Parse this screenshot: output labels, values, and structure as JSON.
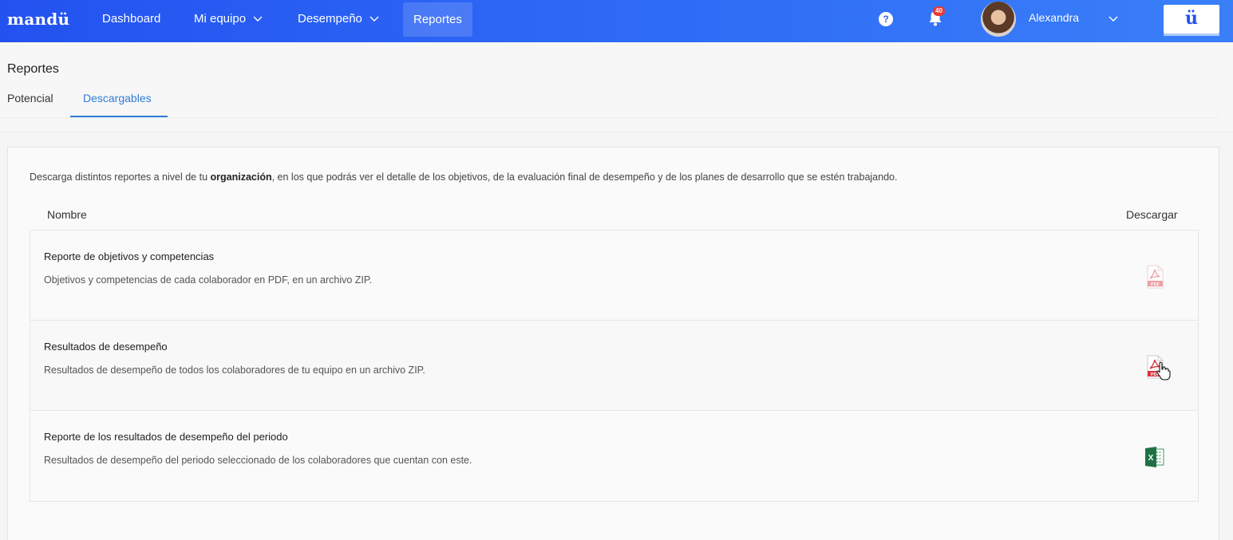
{
  "app": {
    "logo": "mandü",
    "brand_button": "ü"
  },
  "nav": {
    "dashboard": "Dashboard",
    "mi_equipo": "Mi equipo",
    "desempeno": "Desempeño",
    "reportes": "Reportes"
  },
  "user": {
    "name": "Alexandra",
    "notifications": "40",
    "help": "?"
  },
  "page": {
    "title": "Reportes",
    "tabs": [
      {
        "label": "Potencial",
        "active": false
      },
      {
        "label": "Descargables",
        "active": true
      }
    ]
  },
  "content": {
    "description_before": "Descarga distintos reportes a nivel de tu ",
    "description_bold": "organización",
    "description_after": ", en los que podrás ver el detalle de los objetivos, de la evaluación final de desempeño y de los planes de desarrollo que se estén trabajando.",
    "col_name": "Nombre",
    "col_download": "Descargar",
    "reports": [
      {
        "title": "Reporte de objetivos y competencias",
        "subtitle": "Objetivos y competencias de cada colaborador en PDF, en un archivo ZIP.",
        "icon": "pdf-icon"
      },
      {
        "title": "Resultados de desempeño",
        "subtitle": "Resultados de desempeño de todos los colaboradores de tu equipo en un archivo ZIP.",
        "icon": "pdf-icon"
      },
      {
        "title": "Reporte de los resultados de desempeño del periodo",
        "subtitle": "Resultados de desempeño del periodo seleccionado de los colaboradores que cuentan con este.",
        "icon": "excel-icon"
      }
    ]
  },
  "colors": {
    "nav_start": "#2352f0",
    "nav_end": "#3a7ff8",
    "accent": "#2f7cd8",
    "pdf_red": "#d9363e",
    "excel_green": "#1e7145"
  }
}
